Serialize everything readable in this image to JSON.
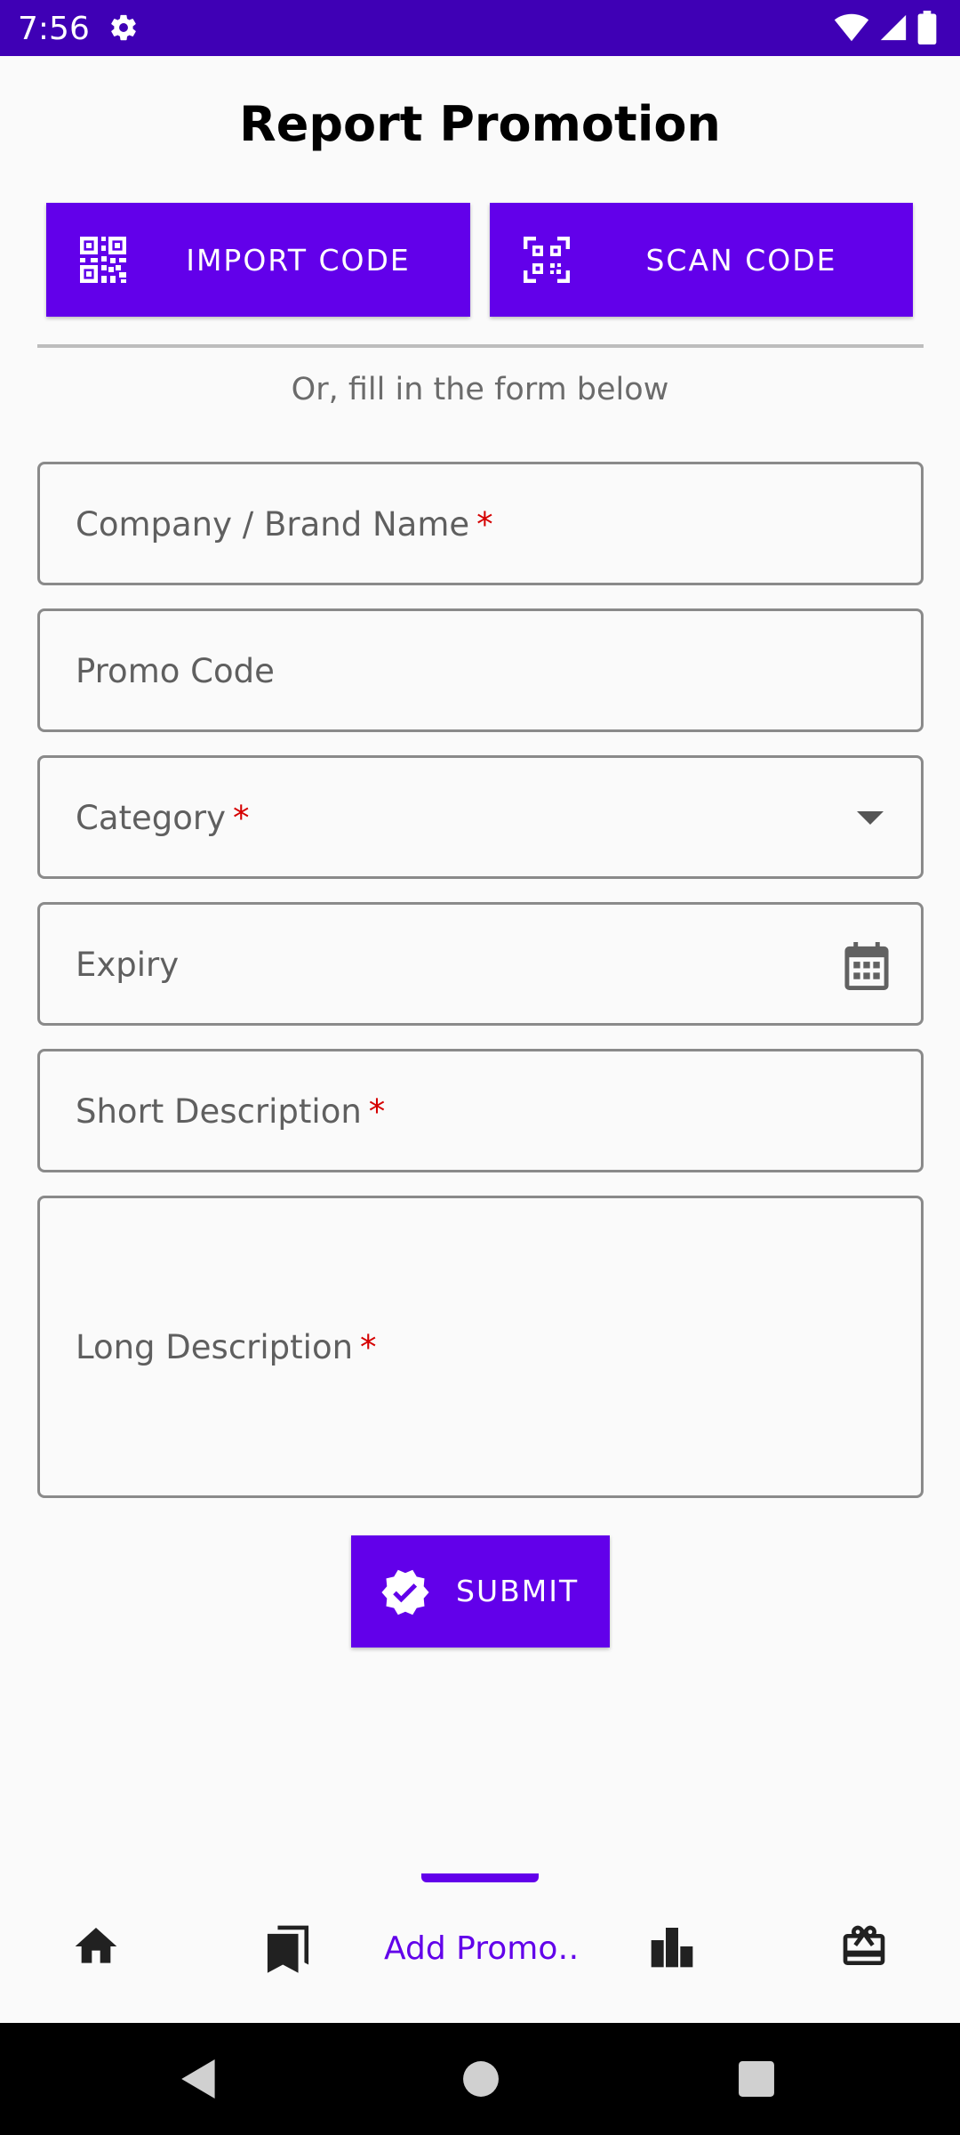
{
  "status_bar": {
    "time": "7:56",
    "color": "#3f00b5"
  },
  "header": {
    "title": "Report Promotion"
  },
  "actions": {
    "import_label": "IMPORT CODE",
    "scan_label": "SCAN CODE",
    "accent": "#6200ea"
  },
  "form": {
    "subtitle": "Or, fill in the form below",
    "required_marker": "*",
    "fields": {
      "company": {
        "label": "Company / Brand Name",
        "required": true
      },
      "promo": {
        "label": "Promo Code",
        "required": false
      },
      "category": {
        "label": "Category",
        "required": true,
        "icon": "dropdown-arrow-icon"
      },
      "expiry": {
        "label": "Expiry",
        "required": false,
        "icon": "calendar-icon"
      },
      "short": {
        "label": "Short Description",
        "required": true
      },
      "long": {
        "label": "Long Description",
        "required": true
      }
    },
    "submit_label": "SUBMIT"
  },
  "bottom_nav": {
    "items": [
      {
        "icon": "home-icon"
      },
      {
        "icon": "bookmarks-icon"
      },
      {
        "label": "Add Promo…",
        "active": true
      },
      {
        "icon": "bar-chart-icon"
      },
      {
        "icon": "gift-card-icon"
      }
    ]
  }
}
